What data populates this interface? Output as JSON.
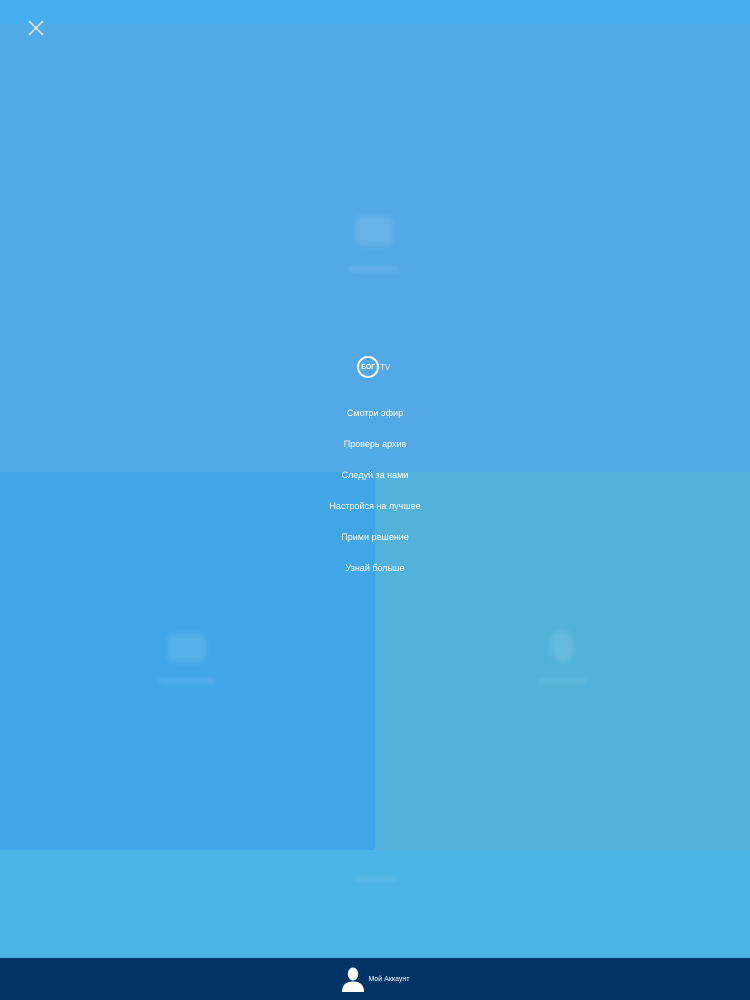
{
  "logo": {
    "mark": "БОГ",
    "suffix": "TV"
  },
  "menu": {
    "items": [
      {
        "label": "Смотри эфир"
      },
      {
        "label": "Проверь архив"
      },
      {
        "label": "Следуй за нами"
      },
      {
        "label": "Настройся на лучшее"
      },
      {
        "label": "Прими решение"
      },
      {
        "label": "Узнай больше"
      }
    ]
  },
  "account": {
    "label": "Мой Аккаунт"
  },
  "colors": {
    "overlay": "#4ea8e6",
    "bottom_bar": "#003366",
    "text": "#ffffff"
  },
  "icons": {
    "close": "close-icon",
    "account": "user-icon"
  }
}
